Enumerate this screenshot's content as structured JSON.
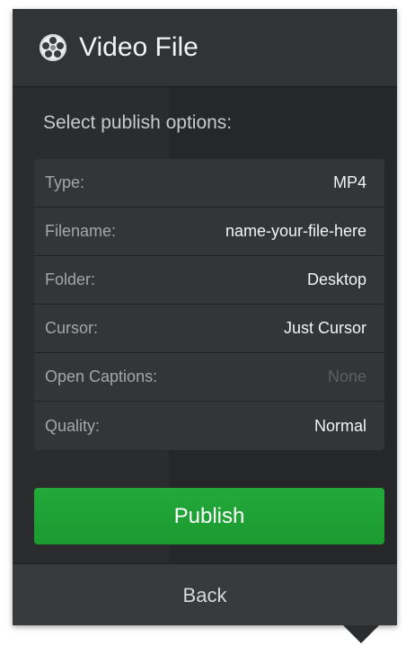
{
  "header": {
    "title": "Video File",
    "icon": "film-reel-icon"
  },
  "subtitle": "Select publish options:",
  "options": [
    {
      "label": "Type:",
      "value": "MP4",
      "disabled": false
    },
    {
      "label": "Filename:",
      "value": "name-your-file-here",
      "disabled": false
    },
    {
      "label": "Folder:",
      "value": "Desktop",
      "disabled": false
    },
    {
      "label": "Cursor:",
      "value": "Just Cursor",
      "disabled": false
    },
    {
      "label": "Open Captions:",
      "value": "None",
      "disabled": true
    },
    {
      "label": "Quality:",
      "value": "Normal",
      "disabled": false
    }
  ],
  "publish_label": "Publish",
  "back_label": "Back",
  "colors": {
    "panel": "#2b2c2e",
    "publish": "#1fa235",
    "disabled_text": "#5d5e60"
  }
}
